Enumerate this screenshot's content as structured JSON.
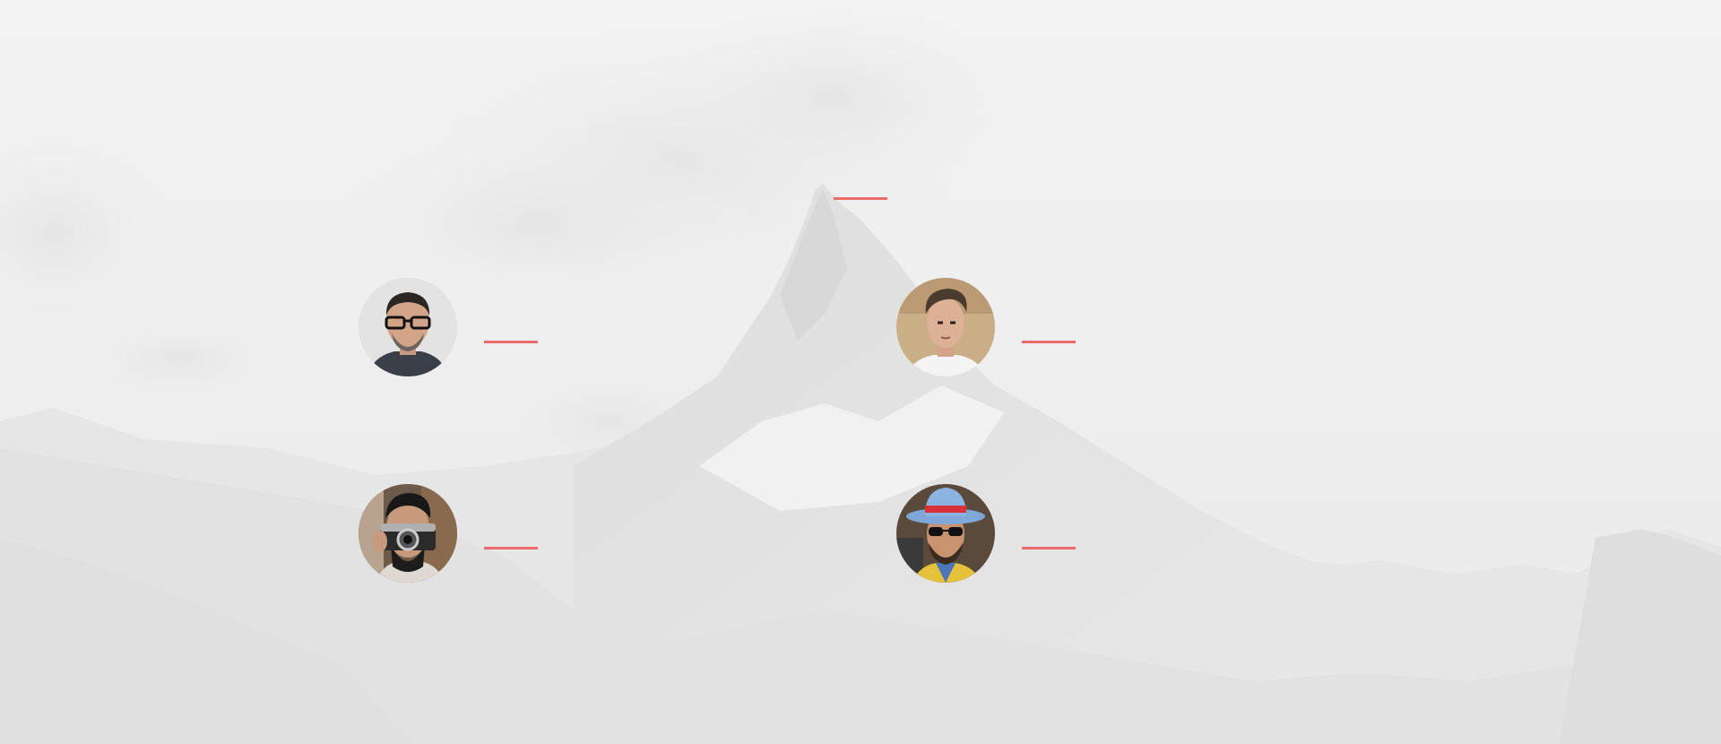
{
  "theme": {
    "accent": "#ee6b6b",
    "background": "#efefef"
  },
  "section": {
    "title": "",
    "subtitle": ""
  },
  "team": [
    {
      "name": "",
      "role": "",
      "photo_icon": "man-with-glasses-avatar"
    },
    {
      "name": "",
      "role": "",
      "photo_icon": "young-man-avatar"
    },
    {
      "name": "",
      "role": "",
      "photo_icon": "man-with-camera-avatar"
    },
    {
      "name": "",
      "role": "",
      "photo_icon": "man-with-hat-sunglasses-avatar"
    }
  ]
}
